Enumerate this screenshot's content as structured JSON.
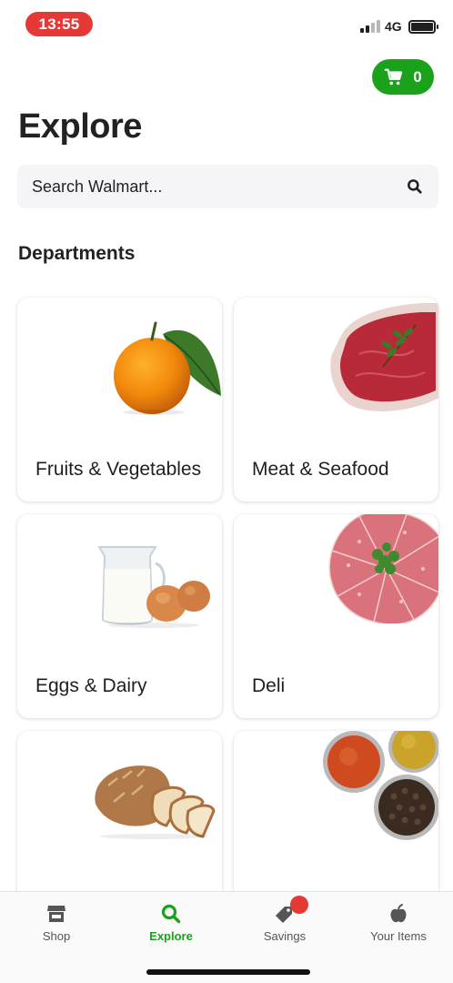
{
  "status_bar": {
    "time": "13:55",
    "network": "4G",
    "time_color": "#e53935"
  },
  "cart": {
    "count": "0",
    "color": "#1aa21a"
  },
  "page": {
    "title": "Explore"
  },
  "search": {
    "placeholder": "Search Walmart..."
  },
  "departments": {
    "title": "Departments",
    "items": [
      {
        "label": "Fruits & Vegetables",
        "icon": "orange-image"
      },
      {
        "label": "Meat & Seafood",
        "icon": "steak-image"
      },
      {
        "label": "Eggs & Dairy",
        "icon": "milk-eggs-image"
      },
      {
        "label": "Deli",
        "icon": "salami-image"
      },
      {
        "label": "",
        "icon": "bread-image"
      },
      {
        "label": "",
        "icon": "spices-image"
      }
    ]
  },
  "tabs": [
    {
      "label": "Shop",
      "icon": "store-icon"
    },
    {
      "label": "Explore",
      "icon": "search-icon",
      "active": true
    },
    {
      "label": "Savings",
      "icon": "tag-icon",
      "badge": true
    },
    {
      "label": "Your Items",
      "icon": "apple-icon"
    }
  ]
}
